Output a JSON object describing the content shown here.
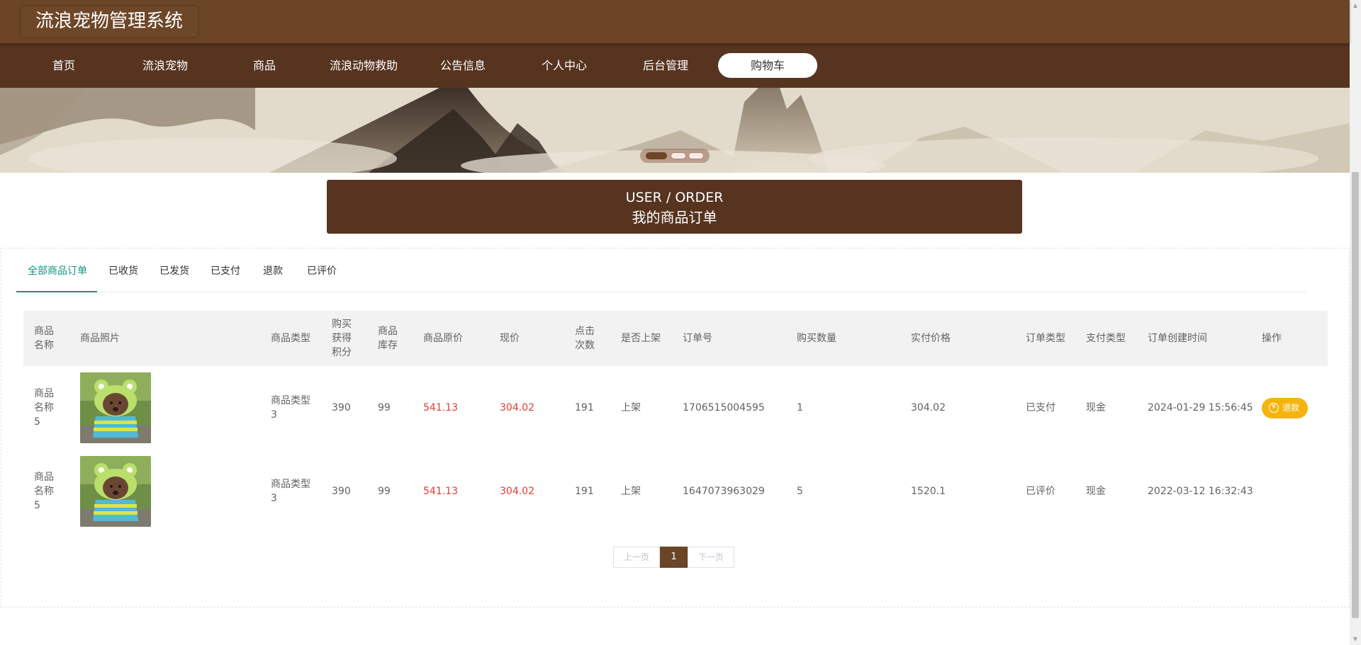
{
  "site": {
    "title": "流浪宠物管理系统"
  },
  "nav": {
    "items": [
      {
        "label": "首页",
        "name": "nav-home",
        "active": false
      },
      {
        "label": "流浪宠物",
        "name": "nav-stray-pets",
        "active": false
      },
      {
        "label": "商品",
        "name": "nav-goods",
        "active": false
      },
      {
        "label": "流浪动物救助",
        "name": "nav-rescue",
        "active": false
      },
      {
        "label": "公告信息",
        "name": "nav-notices",
        "active": false
      },
      {
        "label": "个人中心",
        "name": "nav-profile",
        "active": false
      },
      {
        "label": "后台管理",
        "name": "nav-admin",
        "active": false
      },
      {
        "label": "购物车",
        "name": "nav-cart",
        "active": true
      }
    ]
  },
  "banner": {
    "slides": 3,
    "active_slide": 1
  },
  "section": {
    "title_en": "USER / ORDER",
    "title_zh": "我的商品订单"
  },
  "tabs": [
    {
      "label": "全部商品订单",
      "active": true
    },
    {
      "label": "已收货",
      "active": false
    },
    {
      "label": "已发货",
      "active": false
    },
    {
      "label": "已支付",
      "active": false
    },
    {
      "label": "退款",
      "active": false
    },
    {
      "label": "已评价",
      "active": false
    }
  ],
  "table": {
    "columns": [
      "商品名称",
      "商品照片",
      "商品类型",
      "购买获得积分",
      "商品库存",
      "商品原价",
      "现价",
      "点击次数",
      "是否上架",
      "订单号",
      "购买数量",
      "实付价格",
      "订单类型",
      "支付类型",
      "订单创建时间",
      "操作"
    ],
    "rows": [
      {
        "name": "商品名称5",
        "photo": "poodle-in-frog-hoodie",
        "type": "商品类型3",
        "points": "390",
        "stock": "99",
        "original_price": "541.13",
        "price": "304.02",
        "clicks": "191",
        "on_shelf": "上架",
        "order_no": "1706515004595",
        "quantity": "1",
        "paid": "304.02",
        "order_type": "已支付",
        "pay_type": "现金",
        "created": "2024-01-29 15:56:45",
        "action": "退款"
      },
      {
        "name": "商品名称5",
        "photo": "poodle-in-frog-hoodie",
        "type": "商品类型3",
        "points": "390",
        "stock": "99",
        "original_price": "541.13",
        "price": "304.02",
        "clicks": "191",
        "on_shelf": "上架",
        "order_no": "1647073963029",
        "quantity": "5",
        "paid": "1520.1",
        "order_type": "已评价",
        "pay_type": "现金",
        "created": "2022-03-12 16:32:43",
        "action": ""
      }
    ]
  },
  "pager": {
    "prev": "上一页",
    "page": "1",
    "next": "下一页"
  },
  "colors": {
    "brand": "#6b4526",
    "nav": "#563420",
    "accent_tab": "#11967d",
    "price_red": "#e53d30",
    "refund_btn": "#f5b40d"
  }
}
